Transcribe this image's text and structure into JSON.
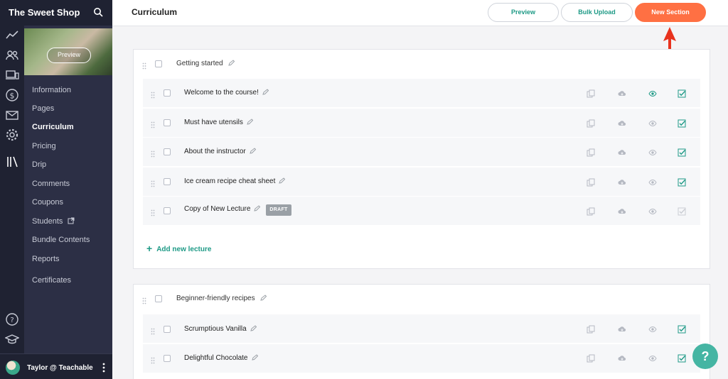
{
  "app": {
    "school_name": "The Sweet Shop"
  },
  "header": {
    "page_title": "Curriculum",
    "preview_label": "Preview",
    "bulk_upload_label": "Bulk Upload",
    "new_section_label": "New Section"
  },
  "course": {
    "preview_label": "Preview"
  },
  "nav": {
    "items": [
      {
        "label": "Information"
      },
      {
        "label": "Pages"
      },
      {
        "label": "Curriculum",
        "active": true
      },
      {
        "label": "Pricing"
      },
      {
        "label": "Drip"
      },
      {
        "label": "Comments"
      },
      {
        "label": "Coupons"
      },
      {
        "label": "Students",
        "external": true
      },
      {
        "label": "Bundle Contents"
      },
      {
        "label": "Reports"
      },
      {
        "label": "Certificates"
      }
    ]
  },
  "user": {
    "name": "Taylor @ Teachable"
  },
  "sections": [
    {
      "title": "Getting started",
      "lectures": [
        {
          "title": "Welcome to the course!",
          "preview": true,
          "published": true
        },
        {
          "title": "Must have utensils",
          "preview": false,
          "published": true
        },
        {
          "title": "About the instructor",
          "preview": false,
          "published": true
        },
        {
          "title": "Ice cream recipe cheat sheet",
          "preview": false,
          "published": true
        },
        {
          "title": "Copy of New Lecture",
          "preview": false,
          "published": false,
          "badge": "DRAFT"
        }
      ],
      "add_lecture_label": "Add new lecture"
    },
    {
      "title": "Beginner-friendly recipes",
      "lectures": [
        {
          "title": "Scrumptious Vanilla",
          "preview": false,
          "published": true
        },
        {
          "title": "Delightful Chocolate",
          "preview": false,
          "published": true
        }
      ]
    }
  ],
  "help": {
    "label": "?"
  },
  "colors": {
    "accent": "#1e9a86",
    "primary_button": "#ff7043",
    "sidebar_dark": "#1f2232",
    "sidebar_panel": "#2c2f45",
    "annotation": "#e8321e"
  }
}
